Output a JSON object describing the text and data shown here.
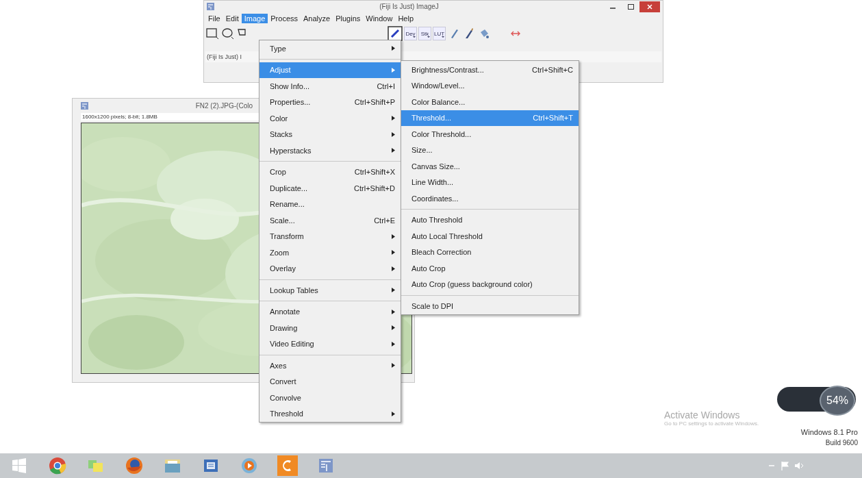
{
  "main_window": {
    "title": "(Fiji Is Just) ImageJ",
    "menu_bar": [
      {
        "label": "File",
        "selected": false
      },
      {
        "label": "Edit",
        "selected": false
      },
      {
        "label": "Image",
        "selected": true
      },
      {
        "label": "Process",
        "selected": false
      },
      {
        "label": "Analyze",
        "selected": false
      },
      {
        "label": "Plugins",
        "selected": false
      },
      {
        "label": "Window",
        "selected": false
      },
      {
        "label": "Help",
        "selected": false
      }
    ],
    "toolbar_left": [
      {
        "kind": "rectangle"
      },
      {
        "kind": "oval"
      },
      {
        "kind": "polygon"
      }
    ],
    "toolbar_right": [
      {
        "kind": "color-picker"
      },
      {
        "kind": "text-menu",
        "label": "Dev"
      },
      {
        "kind": "text-menu",
        "label": "Stk"
      },
      {
        "kind": "text-menu",
        "label": "LUT"
      },
      {
        "kind": "pencil"
      },
      {
        "kind": "brush"
      },
      {
        "kind": "bucket"
      },
      {
        "kind": "blank"
      },
      {
        "kind": "arrows"
      }
    ],
    "status": "(Fiji Is Just) I"
  },
  "image_window": {
    "title": "FN2 (2).JPG-(Colo",
    "info": "1600x1200 pixels; 8-bit; 1.8MB"
  },
  "image_menu": [
    {
      "kind": "item",
      "label": "Type",
      "submenu": true,
      "selected": false
    },
    {
      "kind": "separator"
    },
    {
      "kind": "item",
      "label": "Adjust",
      "submenu": true,
      "selected": true
    },
    {
      "kind": "item",
      "label": "Show Info...",
      "shortcut": "Ctrl+I",
      "submenu": false,
      "selected": false
    },
    {
      "kind": "item",
      "label": "Properties...",
      "shortcut": "Ctrl+Shift+P",
      "submenu": false,
      "selected": false
    },
    {
      "kind": "item",
      "label": "Color",
      "submenu": true,
      "selected": false
    },
    {
      "kind": "item",
      "label": "Stacks",
      "submenu": true,
      "selected": false
    },
    {
      "kind": "item",
      "label": "Hyperstacks",
      "submenu": true,
      "selected": false
    },
    {
      "kind": "separator"
    },
    {
      "kind": "item",
      "label": "Crop",
      "shortcut": "Ctrl+Shift+X",
      "submenu": false,
      "selected": false
    },
    {
      "kind": "item",
      "label": "Duplicate...",
      "shortcut": "Ctrl+Shift+D",
      "submenu": false,
      "selected": false
    },
    {
      "kind": "item",
      "label": "Rename...",
      "submenu": false,
      "selected": false
    },
    {
      "kind": "item",
      "label": "Scale...",
      "shortcut": "Ctrl+E",
      "submenu": false,
      "selected": false
    },
    {
      "kind": "item",
      "label": "Transform",
      "submenu": true,
      "selected": false
    },
    {
      "kind": "item",
      "label": "Zoom",
      "submenu": true,
      "selected": false
    },
    {
      "kind": "item",
      "label": "Overlay",
      "submenu": true,
      "selected": false
    },
    {
      "kind": "separator"
    },
    {
      "kind": "item",
      "label": "Lookup Tables",
      "submenu": true,
      "selected": false
    },
    {
      "kind": "separator"
    },
    {
      "kind": "item",
      "label": "Annotate",
      "submenu": true,
      "selected": false
    },
    {
      "kind": "item",
      "label": "Drawing",
      "submenu": true,
      "selected": false
    },
    {
      "kind": "item",
      "label": "Video Editing",
      "submenu": true,
      "selected": false
    },
    {
      "kind": "separator"
    },
    {
      "kind": "item",
      "label": "Axes",
      "submenu": true,
      "selected": false
    },
    {
      "kind": "item",
      "label": "Convert",
      "submenu": false,
      "selected": false
    },
    {
      "kind": "item",
      "label": "Convolve",
      "submenu": false,
      "selected": false
    },
    {
      "kind": "item",
      "label": "Threshold",
      "submenu": true,
      "selected": false
    }
  ],
  "adjust_menu": [
    {
      "kind": "item",
      "label": "Brightness/Contrast...",
      "shortcut": "Ctrl+Shift+C",
      "selected": false
    },
    {
      "kind": "item",
      "label": "Window/Level...",
      "selected": false
    },
    {
      "kind": "item",
      "label": "Color Balance...",
      "selected": false
    },
    {
      "kind": "item",
      "label": "Threshold...",
      "shortcut": "Ctrl+Shift+T",
      "selected": true
    },
    {
      "kind": "item",
      "label": "Color Threshold...",
      "selected": false
    },
    {
      "kind": "item",
      "label": "Size...",
      "selected": false
    },
    {
      "kind": "item",
      "label": "Canvas Size...",
      "selected": false
    },
    {
      "kind": "item",
      "label": "Line Width...",
      "selected": false
    },
    {
      "kind": "item",
      "label": "Coordinates...",
      "selected": false
    },
    {
      "kind": "separator"
    },
    {
      "kind": "item",
      "label": "Auto Threshold",
      "selected": false
    },
    {
      "kind": "item",
      "label": "Auto Local Threshold",
      "selected": false
    },
    {
      "kind": "item",
      "label": "Bleach Correction",
      "selected": false
    },
    {
      "kind": "item",
      "label": "Auto Crop",
      "selected": false
    },
    {
      "kind": "item",
      "label": "Auto Crop (guess background color)",
      "selected": false
    },
    {
      "kind": "separator"
    },
    {
      "kind": "item",
      "label": "Scale to DPI",
      "selected": false
    }
  ],
  "desktop": {
    "activation_title": "Activate Windows",
    "activation_text": "Go to PC settings to activate Windows.",
    "edition": "Windows 8.1 Pro",
    "build": "Build 9600",
    "gauge": "54%"
  },
  "taskbar": [
    {
      "kind": "start"
    },
    {
      "kind": "browser"
    },
    {
      "kind": "notes"
    },
    {
      "kind": "globe"
    },
    {
      "kind": "folder"
    },
    {
      "kind": "document"
    },
    {
      "kind": "player"
    },
    {
      "kind": "orange-app"
    },
    {
      "kind": "fiji"
    }
  ],
  "tray": [
    {
      "kind": "chevron"
    },
    {
      "kind": "flag"
    },
    {
      "kind": "speaker"
    }
  ]
}
